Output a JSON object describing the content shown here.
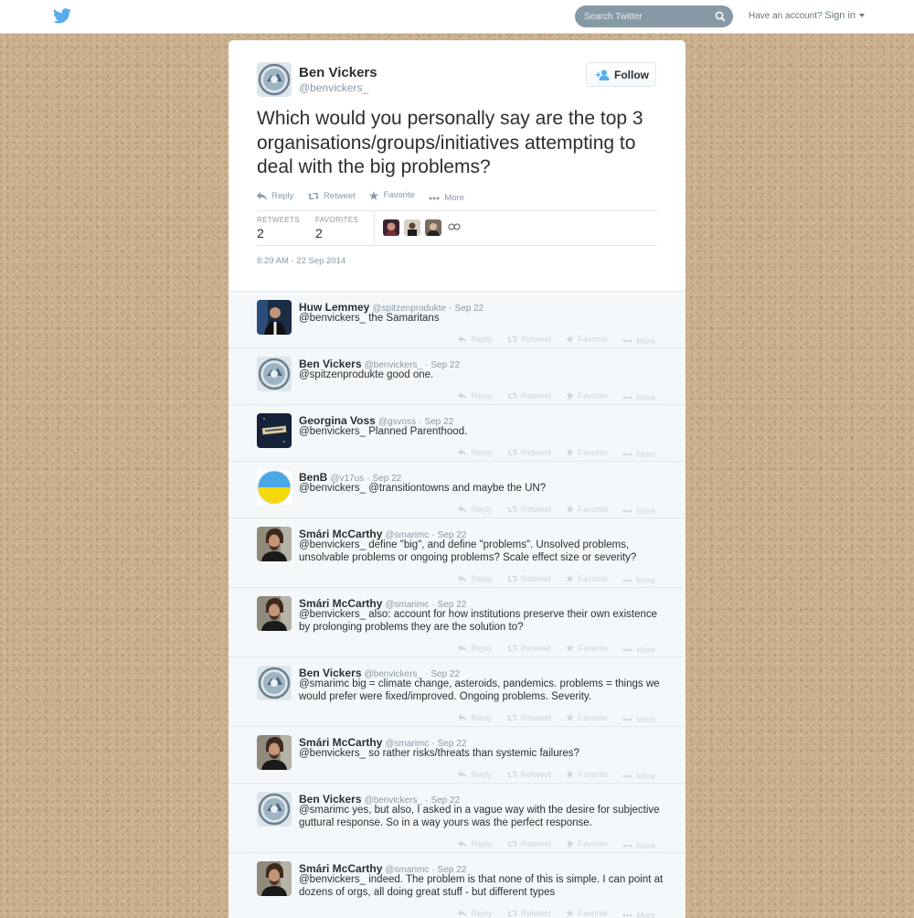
{
  "topbar": {
    "search_placeholder": "Search Twitter",
    "account_text": "Have an account?",
    "signin_label": "Sign in"
  },
  "tweet": {
    "author_name": "Ben Vickers",
    "author_handle": "@benvickers_",
    "follow_label": "Follow",
    "text": "Which would you personally say are the top 3 organisations/groups/initiatives attempting to deal with the big problems?",
    "actions": {
      "reply": "Reply",
      "retweet": "Retweet",
      "favorite": "Favorite",
      "more": "More"
    },
    "retweets_label": "RETWEETS",
    "retweets_count": "2",
    "favorites_label": "FAVORITES",
    "favorites_count": "2",
    "timestamp": "8:29 AM - 22 Sep 2014"
  },
  "reply_actions": {
    "reply": "Reply",
    "retweet": "Retweet",
    "favorite": "Favorite",
    "more": "More"
  },
  "replies": [
    {
      "name": "Huw Lemmey",
      "handle": "@spitzenprodukte",
      "date": "Sep 22",
      "text": "@benvickers_ the Samaritans",
      "avatar": "huw"
    },
    {
      "name": "Ben Vickers",
      "handle": "@benvickers_",
      "date": "Sep 22",
      "text": "@spitzenprodukte good one.",
      "avatar": "ben"
    },
    {
      "name": "Georgina Voss",
      "handle": "@gsvoss",
      "date": "Sep 22",
      "text": "@benvickers_ Planned Parenthood.",
      "avatar": "georgina"
    },
    {
      "name": "BenB",
      "handle": "@v17us",
      "date": "Sep 22",
      "text": "@benvickers_ @transitiontowns and maybe the UN?",
      "avatar": "benb"
    },
    {
      "name": "Smári McCarthy",
      "handle": "@smarimc",
      "date": "Sep 22",
      "text": "@benvickers_ define \"big\", and define \"problems\". Unsolved problems, unsolvable problems or ongoing problems? Scale effect size or severity?",
      "avatar": "smari"
    },
    {
      "name": "Smári McCarthy",
      "handle": "@smarimc",
      "date": "Sep 22",
      "text": "@benvickers_ also: account for how institutions preserve their own existence by prolonging problems they are the solution to?",
      "avatar": "smari"
    },
    {
      "name": "Ben Vickers",
      "handle": "@benvickers_",
      "date": "Sep 22",
      "text": "@smarimc big = climate change, asteroids, pandemics. problems = things we would prefer were fixed/improved. Ongoing problems. Severity.",
      "avatar": "ben"
    },
    {
      "name": "Smári McCarthy",
      "handle": "@smarimc",
      "date": "Sep 22",
      "text": "@benvickers_ so rather risks/threats than systemic failures?",
      "avatar": "smari"
    },
    {
      "name": "Ben Vickers",
      "handle": "@benvickers_",
      "date": "Sep 22",
      "text": "@smarimc yes, but also, I asked in a vague way with the desire for subjective guttural response. So in a way yours was the perfect response.",
      "avatar": "ben"
    },
    {
      "name": "Smári McCarthy",
      "handle": "@smarimc",
      "date": "Sep 22",
      "text": "@benvickers_ indeed. The problem is that none of this is simple. I can point at dozens of orgs, all doing great stuff - but different types",
      "avatar": "smari"
    }
  ],
  "colors": {
    "accent": "#55acee",
    "search_bg": "#8899a6",
    "muted": "#8899a6",
    "reply_bg": "#f5f8fa"
  }
}
